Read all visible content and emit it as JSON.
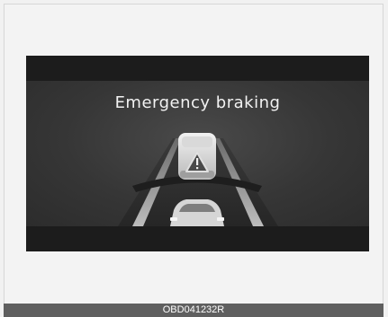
{
  "display": {
    "title": "Emergency braking"
  },
  "icons": {
    "lead_vehicle": "lead-vehicle-icon",
    "warning": "warning-triangle-icon",
    "own_vehicle": "own-vehicle-icon",
    "road": "road-lanes-icon"
  },
  "colors": {
    "display_bg": "#2a2a2a",
    "band": "#1c1c1c",
    "caption_bg": "#5f5f5f",
    "text": "#f2f2f2"
  },
  "caption": {
    "code": "OBD041232R"
  }
}
